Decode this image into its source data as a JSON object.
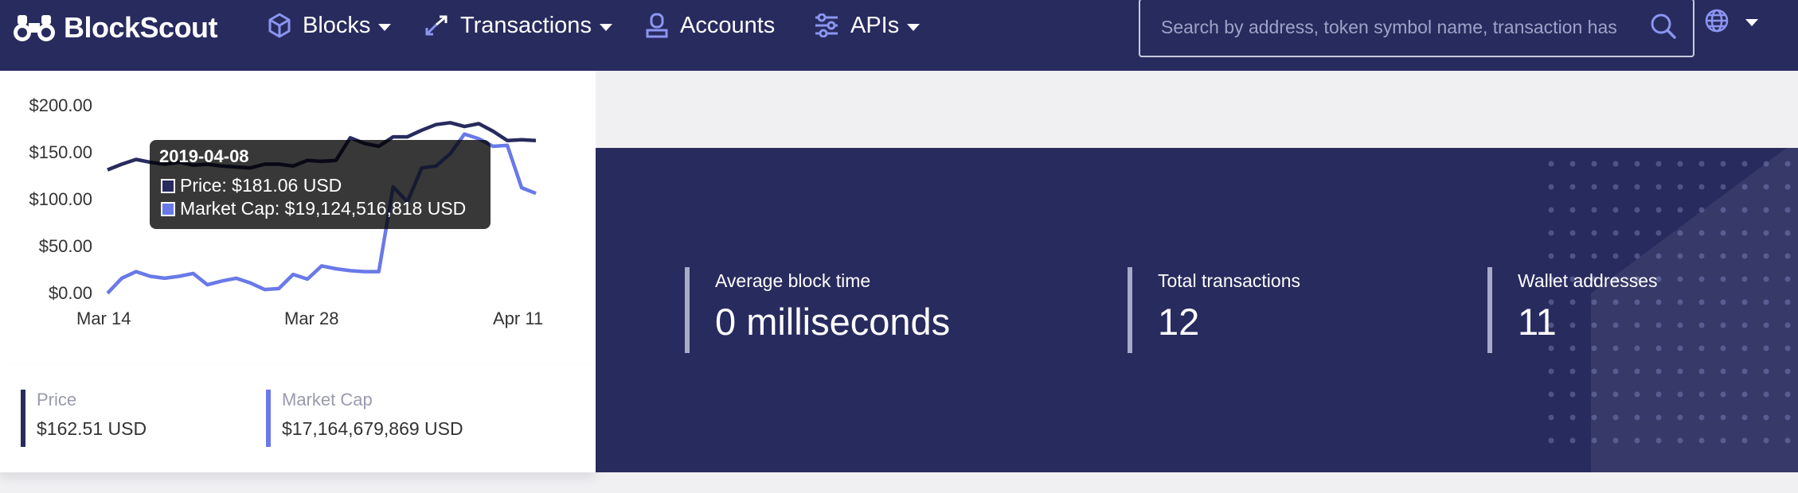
{
  "nav": {
    "brand": "BlockScout",
    "items": [
      {
        "label": "Blocks",
        "icon": "cube-icon",
        "dropdown": true
      },
      {
        "label": "Transactions",
        "icon": "arrows-icon",
        "dropdown": true
      },
      {
        "label": "Accounts",
        "icon": "user-icon",
        "dropdown": false
      },
      {
        "label": "APIs",
        "icon": "sliders-icon",
        "dropdown": true
      }
    ],
    "search_placeholder": "Search by address, token symbol name, transaction has",
    "globe_icon": "globe-icon"
  },
  "chart_data": {
    "type": "line",
    "x": [
      "Mar 13",
      "Mar 14",
      "Mar 15",
      "Mar 16",
      "Mar 17",
      "Mar 18",
      "Mar 19",
      "Mar 20",
      "Mar 21",
      "Mar 22",
      "Mar 23",
      "Mar 24",
      "Mar 25",
      "Mar 26",
      "Mar 27",
      "Mar 28",
      "Mar 29",
      "Mar 30",
      "Mar 31",
      "Apr 1",
      "Apr 2",
      "Apr 3",
      "Apr 4",
      "Apr 5",
      "Apr 6",
      "Apr 7",
      "Apr 8",
      "Apr 9",
      "Apr 10",
      "Apr 11",
      "Apr 12"
    ],
    "series": [
      {
        "name": "Price",
        "color": "#282b5e",
        "values": [
          132,
          138,
          143,
          140,
          138,
          140,
          137,
          138,
          136,
          135,
          134,
          138,
          138,
          136,
          142,
          141,
          142,
          166,
          160,
          157,
          167,
          167,
          174,
          180,
          182,
          178,
          181,
          173,
          163,
          164,
          163
        ]
      },
      {
        "name": "Market Cap",
        "color": "#6979e8",
        "values": [
          1,
          17,
          24,
          19,
          17,
          19,
          22,
          10,
          14,
          17,
          12,
          5,
          6,
          21,
          16,
          30,
          27,
          25,
          24,
          24,
          114,
          98,
          134,
          136,
          149,
          170,
          165,
          157,
          158,
          113,
          107
        ]
      }
    ],
    "yticks": [
      "$200.00",
      "$150.00",
      "$100.00",
      "$50.00",
      "$0.00"
    ],
    "xticks": [
      "Mar 14",
      "Mar 28",
      "Apr 11"
    ],
    "ylim": [
      0,
      200
    ],
    "tooltip": {
      "title": "2019-04-08",
      "price": "Price: $181.06 USD",
      "market_cap": "Market Cap: $19,124,516,818 USD"
    }
  },
  "stats": [
    {
      "label": "Price",
      "value": "$162.51 USD",
      "color": "#282b5e"
    },
    {
      "label": "Market Cap",
      "value": "$17,164,679,869 USD",
      "color": "#6979e8"
    }
  ],
  "dashboard": [
    {
      "label": "Average block time",
      "value": "0 milliseconds"
    },
    {
      "label": "Total transactions",
      "value": "12"
    },
    {
      "label": "Wallet addresses",
      "value": "11"
    }
  ]
}
